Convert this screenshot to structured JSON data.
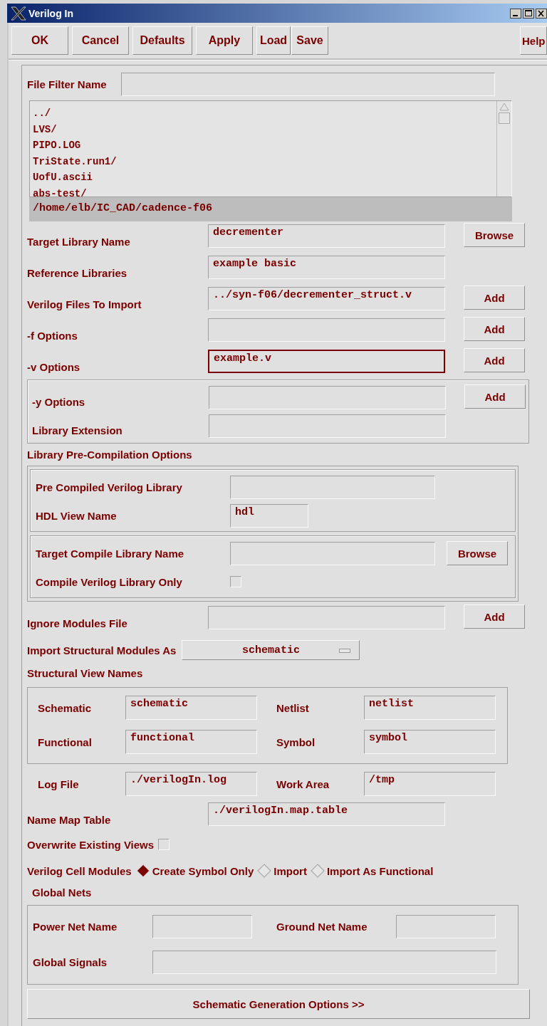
{
  "window": {
    "title": "Verilog In"
  },
  "toolbar": [
    "OK",
    "Cancel",
    "Defaults",
    "Apply",
    "Load",
    "Save",
    "Help"
  ],
  "file_filter": {
    "label": "File Filter Name"
  },
  "file_list": [
    "../",
    "LVS/",
    "PIPO.LOG",
    "TriState.run1/",
    "UofU.ascii",
    "abs-test/"
  ],
  "current_directory": "/home/elb/IC_CAD/cadence-f06",
  "main_rows": [
    {
      "label": "Target Library Name",
      "value": "decrementer",
      "button": "Browse",
      "focused": false
    },
    {
      "label": "Reference Libraries",
      "value": "example basic",
      "focused": false
    },
    {
      "label": "Verilog Files To Import",
      "value": "../syn-f06/decrementer_struct.v",
      "button": "Add",
      "focused": false
    },
    {
      "label": "-f Options",
      "button": "Add",
      "focused": false
    },
    {
      "label": "-v Options",
      "value": "example.v",
      "button": "Add",
      "focused": true
    }
  ],
  "y_group": [
    {
      "label": "-y Options",
      "button": "Add"
    },
    {
      "label": "Library Extension"
    }
  ],
  "precompilation": {
    "title": "Library Pre-Compilation Options",
    "group_1": [
      {
        "kind": "field",
        "label": "Pre Compiled Verilog Library"
      },
      {
        "kind": "short_field",
        "label": "HDL View Name",
        "value": "hdl"
      }
    ],
    "group_2": [
      {
        "kind": "field",
        "label": "Target Compile Library Name",
        "button": "Browse"
      },
      {
        "kind": "checkbox",
        "label": "Compile Verilog Library Only",
        "checked": false
      }
    ]
  },
  "ignore_modules": {
    "label": "Ignore Modules File",
    "button": "Add"
  },
  "import_as": {
    "label": "Import Structural Modules As",
    "value": "schematic"
  },
  "structural_view_names": {
    "title": "Structural View Names",
    "rows": [
      [
        {
          "label": "Schematic",
          "value": "schematic"
        },
        {
          "label": "Netlist",
          "value": "netlist"
        }
      ],
      [
        {
          "label": "Functional",
          "value": "functional"
        },
        {
          "label": "Symbol",
          "value": "symbol"
        }
      ]
    ]
  },
  "log_fields": [
    {
      "label": "Log File",
      "value": "./verilogIn.log"
    },
    {
      "label": "Work Area",
      "value": "/tmp"
    }
  ],
  "name_map": {
    "label": "Name Map Table",
    "value": "./verilogIn.map.table"
  },
  "overwrite": {
    "label": "Overwrite Existing Views",
    "checked": false
  },
  "cell_modules": {
    "label": "Verilog Cell Modules",
    "options": [
      {
        "label": "Create Symbol Only",
        "selected": true
      },
      {
        "label": "Import",
        "selected": false
      },
      {
        "label": "Import As Functional",
        "selected": false
      }
    ]
  },
  "global_nets": {
    "title": "Global Nets",
    "rows": [
      [
        {
          "label": "Power Net Name"
        },
        {
          "label": "Ground Net Name"
        }
      ],
      [
        {
          "label": "Global Signals"
        }
      ]
    ]
  },
  "more_button": "Schematic Generation Options >>"
}
